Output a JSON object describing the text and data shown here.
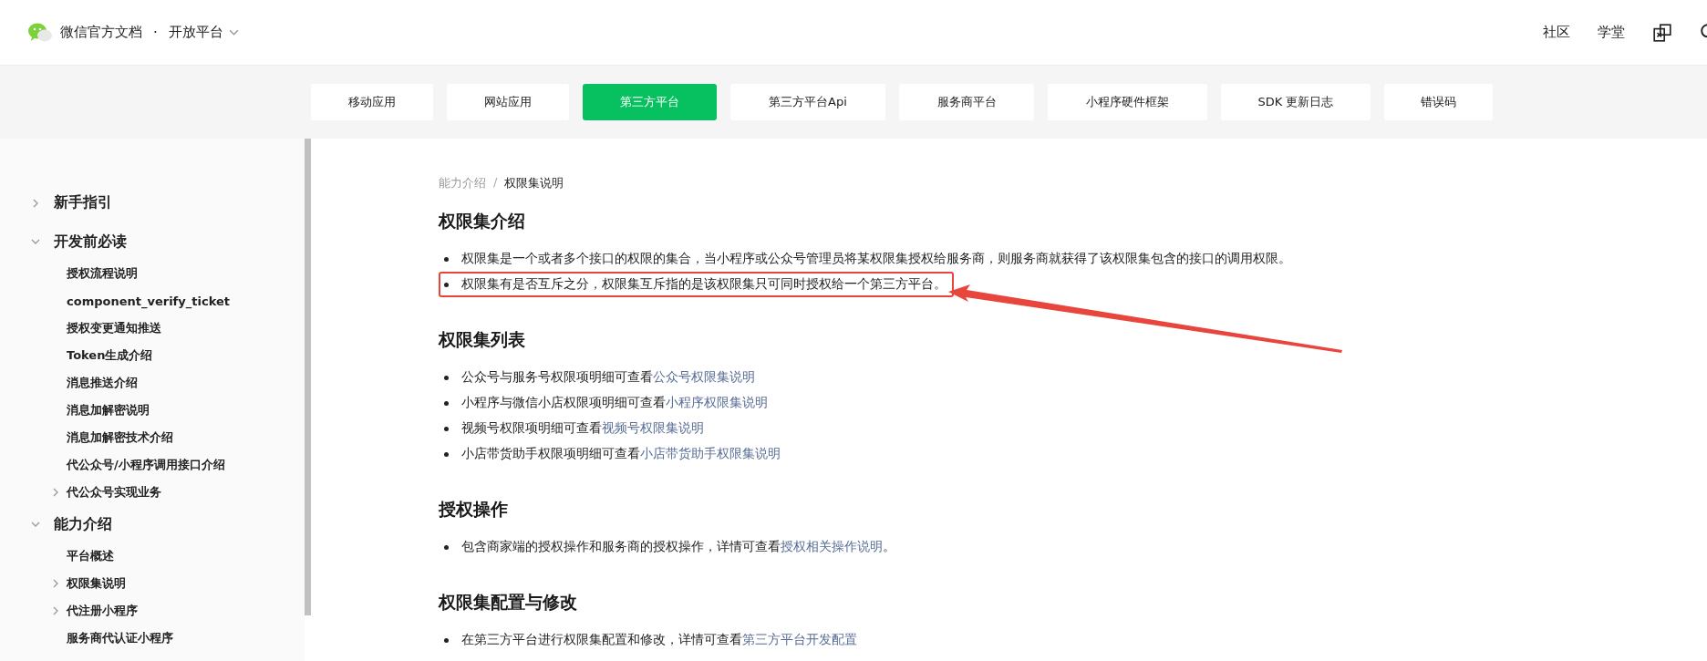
{
  "header": {
    "site_title": "微信官方文档",
    "separator": "·",
    "platform": "开放平台",
    "links": [
      "社区",
      "学堂"
    ]
  },
  "nav_tabs": [
    {
      "label": "移动应用",
      "selected": false
    },
    {
      "label": "网站应用",
      "selected": false
    },
    {
      "label": "第三方平台",
      "selected": true
    },
    {
      "label": "第三方平台Api",
      "selected": false
    },
    {
      "label": "服务商平台",
      "selected": false
    },
    {
      "label": "小程序硬件框架",
      "selected": false
    },
    {
      "label": "SDK 更新日志",
      "selected": false
    },
    {
      "label": "错误码",
      "selected": false
    }
  ],
  "sidebar": {
    "items": [
      {
        "label": "新手指引",
        "expanded": false
      },
      {
        "label": "开发前必读",
        "expanded": true,
        "children": [
          {
            "label": "授权流程说明"
          },
          {
            "label": "component_verify_ticket"
          },
          {
            "label": "授权变更通知推送"
          },
          {
            "label": "Token生成介绍"
          },
          {
            "label": "消息推送介绍"
          },
          {
            "label": "消息加解密说明"
          },
          {
            "label": "消息加解密技术介绍"
          },
          {
            "label": "代公众号/小程序调用接口介绍"
          },
          {
            "label": "代公众号实现业务",
            "expanded": false
          }
        ]
      },
      {
        "label": "能力介绍",
        "expanded": true,
        "children": [
          {
            "label": "平台概述"
          },
          {
            "label": "权限集说明",
            "expanded": false
          },
          {
            "label": "代注册小程序",
            "expanded": false
          },
          {
            "label": "服务商代认证小程序"
          }
        ]
      }
    ]
  },
  "breadcrumb": [
    "能力介绍",
    "/",
    "权限集说明"
  ],
  "sections": [
    {
      "heading": "权限集介绍",
      "items": [
        {
          "text": "权限集是一个或者多个接口的权限的集合，当小程序或公众号管理员将某权限集授权给服务商，则服务商就获得了该权限集包含的接口的调用权限。"
        },
        {
          "text": "权限集有是否互斥之分，权限集互斥指的是该权限集只可同时授权给一个第三方平台。",
          "highlighted": true
        }
      ]
    },
    {
      "heading": "权限集列表",
      "items": [
        {
          "text": "公众号与服务号权限项明细可查看",
          "link": "公众号权限集说明"
        },
        {
          "text": "小程序与微信小店权限项明细可查看",
          "link": "小程序权限集说明"
        },
        {
          "text": "视频号权限项明细可查看",
          "link": "视频号权限集说明"
        },
        {
          "text": "小店带货助手权限项明细可查看",
          "link": "小店带货助手权限集说明"
        }
      ]
    },
    {
      "heading": "授权操作",
      "items": [
        {
          "text": "包含商家端的授权操作和服务商的授权操作，详情可查看",
          "link": "授权相关操作说明",
          "suffix": "。"
        }
      ]
    },
    {
      "heading": "权限集配置与修改",
      "items": [
        {
          "text": "在第三方平台进行权限集配置和修改，详情可查看",
          "link": "第三方平台开发配置"
        }
      ]
    }
  ]
}
